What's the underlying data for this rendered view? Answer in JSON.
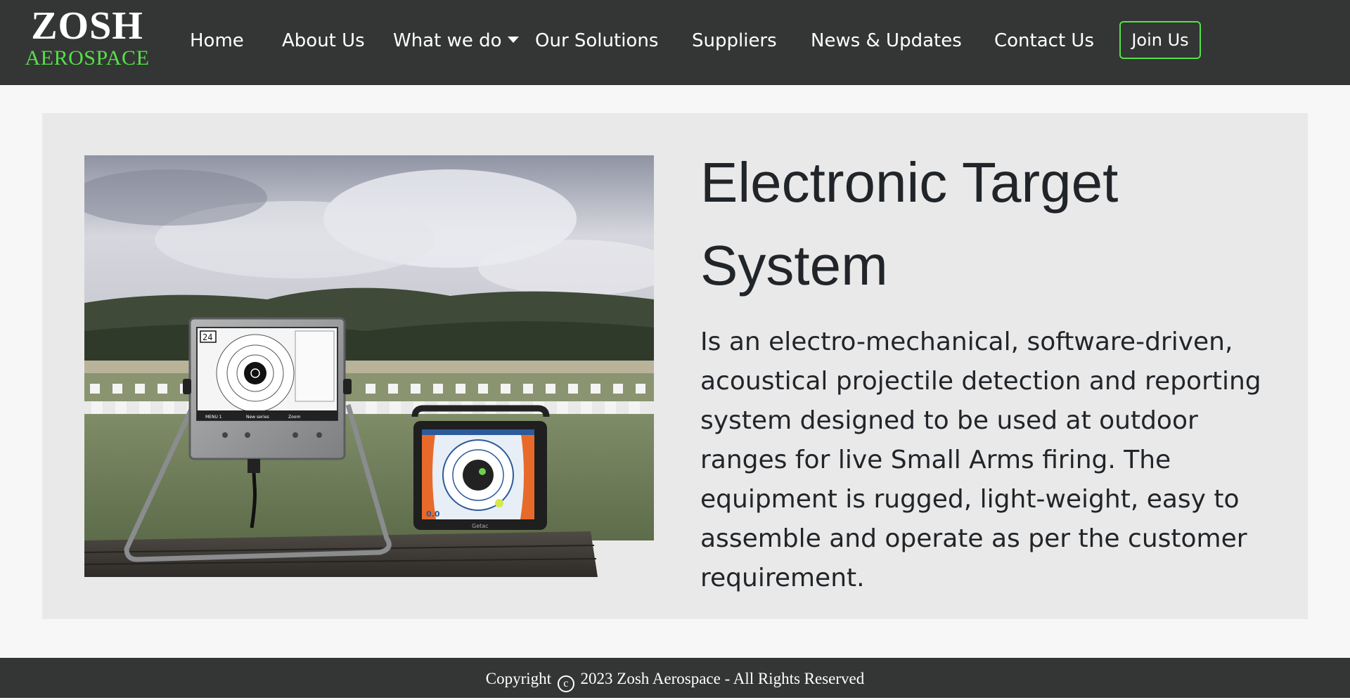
{
  "brand": {
    "name": "ZOSH",
    "tagline": "AEROSPACE"
  },
  "nav": {
    "items": [
      {
        "label": "Home"
      },
      {
        "label": "About Us"
      },
      {
        "label": "What we do",
        "has_dropdown": true
      },
      {
        "label": "Our Solutions"
      },
      {
        "label": "Suppliers"
      },
      {
        "label": "News & Updates"
      },
      {
        "label": "Contact Us"
      }
    ],
    "cta": "Join Us"
  },
  "hero": {
    "title": "Electronic Target System",
    "description": "Is an electro-mechanical, software-driven, acoustical projectile detection and reporting system designed to be used at outdoor ranges for live Small Arms firing. The equipment is rugged, light-weight, easy to assemble and operate as per the customer requirement.",
    "image": {
      "lcd_counter": "24",
      "lcd_button_1": "MENU 1",
      "lcd_button_2": "New series",
      "lcd_button_3": "Zoom",
      "tablet_score": "0.0",
      "tablet_brand": "Getac"
    }
  },
  "footer": {
    "copyright_prefix": "Copyright",
    "copyright_symbol": "c",
    "copyright_text": "2023 Zosh Aerospace - All Rights Reserved"
  },
  "colors": {
    "navbar_bg": "#343635",
    "brand_accent": "#55e048",
    "hero_bg": "#e9e9e9",
    "page_bg": "#f7f7f7",
    "text_dark": "#212529"
  }
}
